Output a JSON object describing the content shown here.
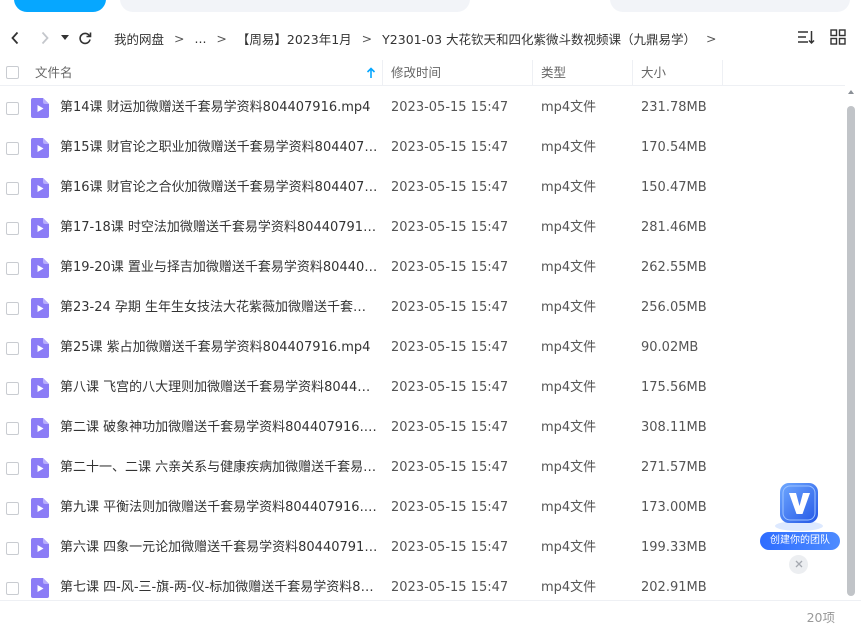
{
  "navigation": {
    "back_icon": "chevron-left-icon",
    "forward_icon": "chevron-right-icon",
    "history_icon": "caret-down-icon",
    "refresh_icon": "refresh-icon"
  },
  "breadcrumb": {
    "items": [
      "我的网盘",
      "...",
      "【周易】2023年1月",
      "Y2301-03 大花钦天和四化紫微斗数视频课（九鼎易学）"
    ],
    "separator": ">"
  },
  "view_controls": {
    "sort_icon": "sort-list-icon",
    "grid_icon": "grid-view-icon"
  },
  "table": {
    "columns": {
      "name": "文件名",
      "modified": "修改时间",
      "type": "类型",
      "size": "大小"
    },
    "sort_icon": "sort-ascending-icon",
    "rows": [
      {
        "name": "第14课 财运加微赠送千套易学资料804407916.mp4",
        "modified": "2023-05-15 15:47",
        "type": "mp4文件",
        "size": "231.78MB"
      },
      {
        "name": "第15课 财官论之职业加微赠送千套易学资料804407916....",
        "modified": "2023-05-15 15:47",
        "type": "mp4文件",
        "size": "170.54MB"
      },
      {
        "name": "第16课 财官论之合伙加微赠送千套易学资料804407916....",
        "modified": "2023-05-15 15:47",
        "type": "mp4文件",
        "size": "150.47MB"
      },
      {
        "name": "第17-18课 时空法加微赠送千套易学资料804407916.mp4",
        "modified": "2023-05-15 15:47",
        "type": "mp4文件",
        "size": "281.46MB"
      },
      {
        "name": "第19-20课 置业与择吉加微赠送千套易学资料804407916....",
        "modified": "2023-05-15 15:47",
        "type": "mp4文件",
        "size": "262.55MB"
      },
      {
        "name": "第23-24 孕期 生年生女技法大花紫薇加微赠送千套易学...",
        "modified": "2023-05-15 15:47",
        "type": "mp4文件",
        "size": "256.05MB"
      },
      {
        "name": "第25课 紫占加微赠送千套易学资料804407916.mp4",
        "modified": "2023-05-15 15:47",
        "type": "mp4文件",
        "size": "90.02MB"
      },
      {
        "name": "第八课 飞宫的八大理则加微赠送千套易学资料80440791...",
        "modified": "2023-05-15 15:47",
        "type": "mp4文件",
        "size": "175.56MB"
      },
      {
        "name": "第二课 破象神功加微赠送千套易学资料804407916.mp4",
        "modified": "2023-05-15 15:47",
        "type": "mp4文件",
        "size": "308.11MB"
      },
      {
        "name": "第二十一、二课 六亲关系与健康疾病加微赠送千套易学资...",
        "modified": "2023-05-15 15:47",
        "type": "mp4文件",
        "size": "271.57MB"
      },
      {
        "name": "第九课 平衡法则加微赠送千套易学资料804407916.mp4",
        "modified": "2023-05-15 15:47",
        "type": "mp4文件",
        "size": "173.00MB"
      },
      {
        "name": "第六课 四象一元论加微赠送千套易学资料804407916.mp4",
        "modified": "2023-05-15 15:47",
        "type": "mp4文件",
        "size": "199.33MB"
      },
      {
        "name": "第七课 四-风-三-旗-两-仪-标加微赠送千套易学资料8044...",
        "modified": "2023-05-15 15:47",
        "type": "mp4文件",
        "size": "202.91MB"
      }
    ]
  },
  "footer": {
    "count": "20项"
  },
  "widget": {
    "label": "创建你的团队",
    "icon": "team-v-logo-icon",
    "close_icon": "close-icon"
  },
  "colors": {
    "accent": "#06a7ff",
    "video_icon": "#8b7cf6",
    "widget_blue": "#2f6dff"
  }
}
